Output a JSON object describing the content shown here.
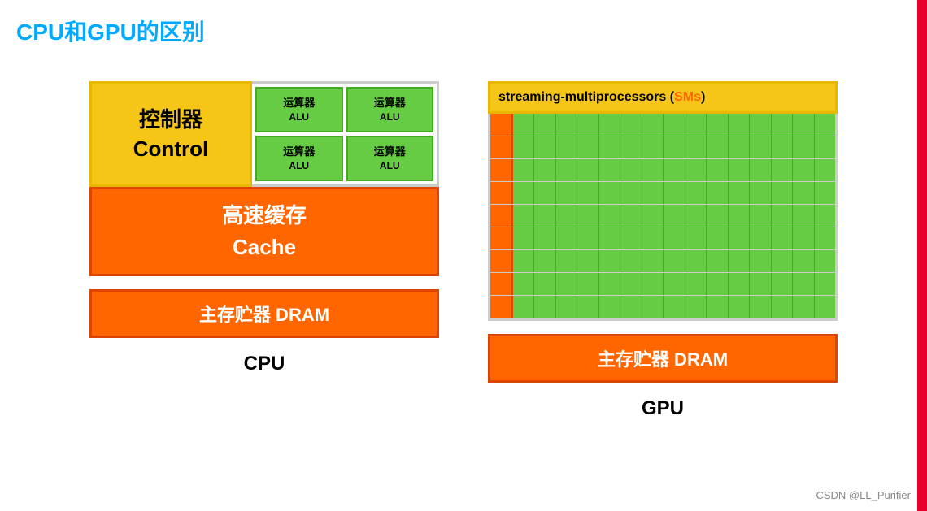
{
  "page": {
    "title": "CPU和GPU的区别",
    "background": "#ffffff"
  },
  "cpu": {
    "control_cn": "控制器",
    "control_en": "Control",
    "alu_cn": "运算器",
    "alu_en": "ALU",
    "cache_cn": "高速缓存",
    "cache_en": "Cache",
    "dram": "主存贮器 DRAM",
    "label": "CPU"
  },
  "gpu": {
    "sm_label": "streaming-multiprocessors (",
    "sm_colored": "SMs",
    "sm_close": ")",
    "dram": "主存贮器 DRAM",
    "label": "GPU",
    "rows": 9,
    "cols": 15
  },
  "watermark": "CSDN @LL_Purifier"
}
